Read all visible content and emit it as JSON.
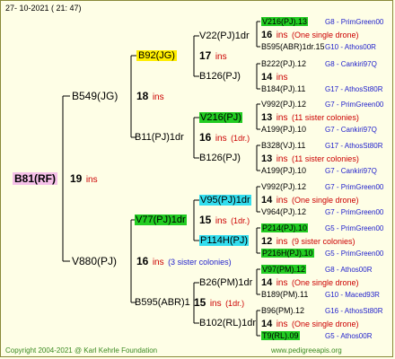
{
  "header": {
    "date": "27-  10-2021  (  21:  47)"
  },
  "root": {
    "name": "B81(RF)",
    "gen": "19",
    "ins": "ins"
  },
  "gen1": {
    "top": {
      "name": "B549(JG)",
      "gen": "18",
      "ins": "ins"
    },
    "bottom": {
      "name": "V880(PJ)",
      "gen": "16",
      "ins": "ins",
      "note": "(3 sister colonies)"
    }
  },
  "gen2": [
    {
      "name": "B92(JG)",
      "gen": "17",
      "ins": "ins"
    },
    {
      "name": "B11(PJ)1dr",
      "gen": "16",
      "ins": "ins",
      "note": "(1dr.)"
    },
    {
      "name": "V77(PJ)1dr",
      "gen": "15",
      "ins": "ins",
      "note": "(1dr.)"
    },
    {
      "name": "B595(ABR)1",
      "gen": "15",
      "ins": "ins",
      "note": "(1dr.)"
    }
  ],
  "gen3": [
    {
      "name": "V22(PJ)1dr"
    },
    {
      "name": "B126(PJ)"
    },
    {
      "name": "V216(PJ)"
    },
    {
      "name": "B126(PJ)"
    },
    {
      "name": "V95(PJ)1dr"
    },
    {
      "name": "P114H(PJ)"
    },
    {
      "name": "B26(PM)1dr"
    },
    {
      "name": "B102(RL)1dr"
    }
  ],
  "gen4": [
    {
      "top": "V216(PJ).13",
      "top_breeder": "G8 - PrimGreen00",
      "mid_gen": "16",
      "mid_ins": "ins",
      "mid_note": "(One single drone)",
      "bottom": "B595(ABR)1dr.15",
      "bottom_breeder": "G10 - Athos00R"
    },
    {
      "top": "B222(PJ).12",
      "top_breeder": "G8 - Cankiri97Q",
      "mid_gen": "14",
      "mid_ins": "ins",
      "mid_note": "",
      "bottom": "B184(PJ).11",
      "bottom_breeder": "G17 - AthosSt80R"
    },
    {
      "top": "V992(PJ).12",
      "top_breeder": "G7 - PrimGreen00",
      "mid_gen": "13",
      "mid_ins": "ins",
      "mid_note": "(11 sister colonies)",
      "bottom": "A199(PJ).10",
      "bottom_breeder": "G7 - Cankiri97Q"
    },
    {
      "top": "B328(VJ).11",
      "top_breeder": "G17 - AthosSt80R",
      "mid_gen": "13",
      "mid_ins": "ins",
      "mid_note": "(11 sister colonies)",
      "bottom": "A199(PJ).10",
      "bottom_breeder": "G7 - Cankiri97Q"
    },
    {
      "top": "V992(PJ).12",
      "top_breeder": "G7 - PrimGreen00",
      "mid_gen": "14",
      "mid_ins": "ins",
      "mid_note": "(One single drone)",
      "bottom": "V964(PJ).12",
      "bottom_breeder": "G7 - PrimGreen00"
    },
    {
      "top": "P214(PJ).10",
      "top_breeder": "G5 - PrimGreen00",
      "mid_gen": "12",
      "mid_ins": "ins",
      "mid_note": "(9 sister colonies)",
      "bottom": "P216H(PJ).10",
      "bottom_breeder": "G5 - PrimGreen00"
    },
    {
      "top": "V97(PM).12",
      "top_breeder": "G8 - Athos00R",
      "mid_gen": "14",
      "mid_ins": "ins",
      "mid_note": "(One single drone)",
      "bottom": "B189(PM).11",
      "bottom_breeder": "G10 - Maced93R"
    },
    {
      "top": "B96(PM).12",
      "top_breeder": "G16 - AthosSt80R",
      "mid_gen": "14",
      "mid_ins": "ins",
      "mid_note": "(One single drone)",
      "bottom": "T9(RL).09",
      "bottom_breeder": "G5 - Athos00R"
    }
  ],
  "footer": {
    "copyright": "Copyright 2004-2021 @ Karl Kehrle Foundation",
    "site": "www.pedigreeapis.org"
  },
  "colors": {
    "green": "#22cc22",
    "yellow": "#ffee00",
    "cyan": "#33ddee",
    "pink": "#f5c0e8",
    "red": "#cc0000",
    "blue": "#2222cc"
  }
}
